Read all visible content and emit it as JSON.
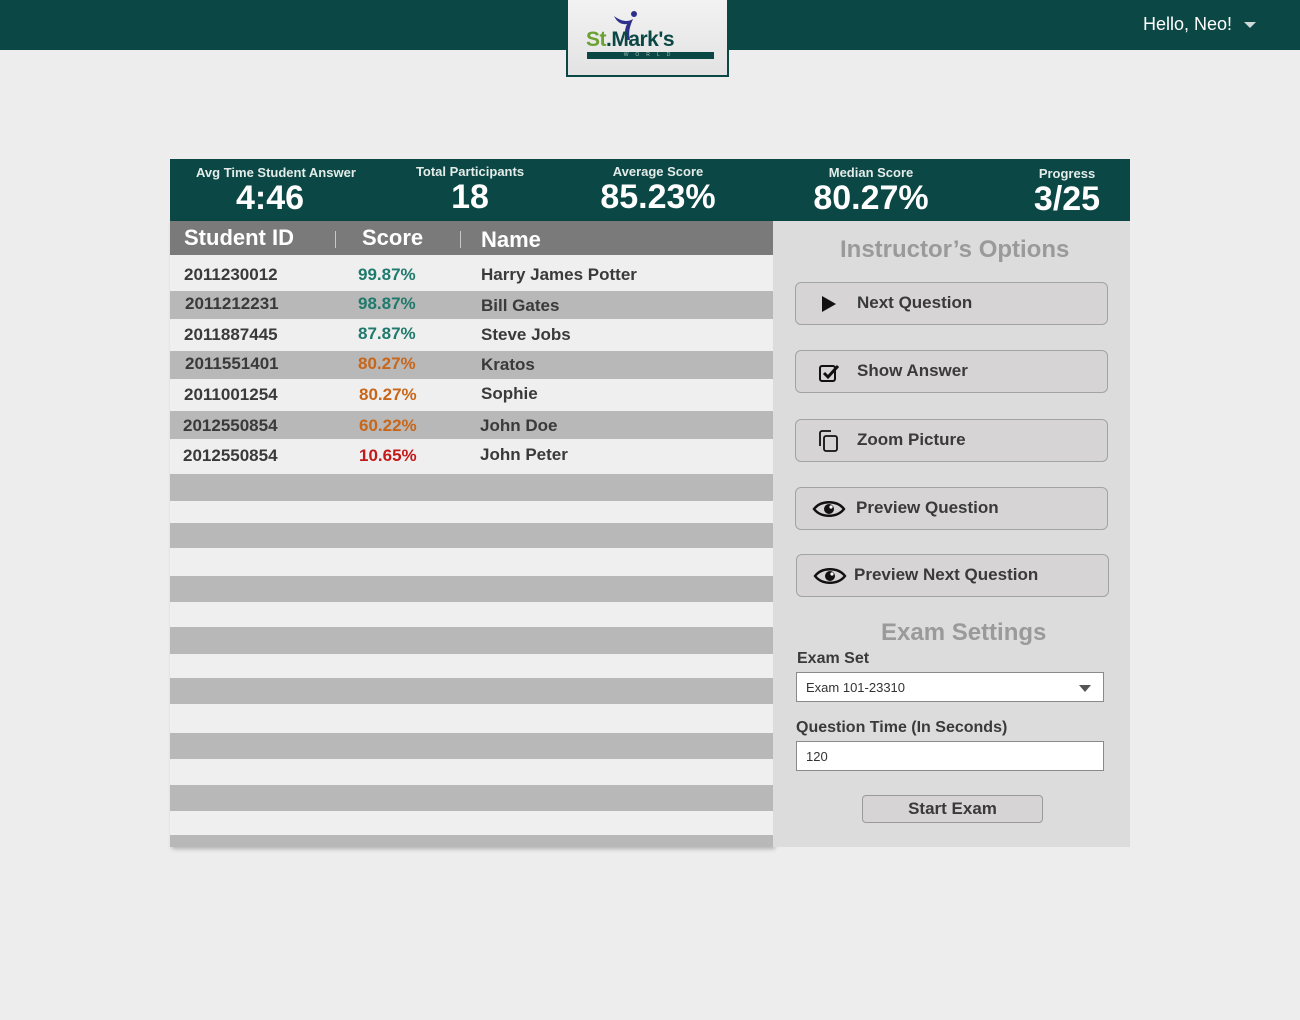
{
  "header": {
    "logo_text_st": "St",
    "logo_text_rest": ".Mark's",
    "logo_sub": "WORLD",
    "greeting": "Hello, Neo!"
  },
  "stats": [
    {
      "label": "Avg Time Student Answer",
      "value": "4:46"
    },
    {
      "label": "Total Participants",
      "value": "18"
    },
    {
      "label": "Average Score",
      "value": "85.23%"
    },
    {
      "label": "Median Score",
      "value": "80.27%"
    },
    {
      "label": "Progress",
      "value": "3/25"
    }
  ],
  "table": {
    "columns": [
      "Student ID",
      "Score",
      "Name"
    ],
    "rows": [
      {
        "id": "2011230012",
        "score": "99.87%",
        "name": "Harry James Potter",
        "color": "#1f7a6c"
      },
      {
        "id": "2011212231",
        "score": "98.87%",
        "name": "Bill Gates",
        "color": "#1f7a6c"
      },
      {
        "id": "2011887445",
        "score": "87.87%",
        "name": "Steve Jobs",
        "color": "#1f7a6c"
      },
      {
        "id": "2011551401",
        "score": "80.27%",
        "name": "Kratos",
        "color": "#c8661a"
      },
      {
        "id": "2011001254",
        "score": "80.27%",
        "name": "Sophie",
        "color": "#c8661a"
      },
      {
        "id": "2012550854",
        "score": "60.22%",
        "name": "John Doe",
        "color": "#c8661a"
      },
      {
        "id": "2012550854",
        "score": "10.65%",
        "name": "John Peter",
        "color": "#c21a1a"
      }
    ]
  },
  "options": {
    "title": "Instructor’s Options",
    "buttons": [
      {
        "label": "Next Question",
        "icon": "play-icon"
      },
      {
        "label": "Show Answer",
        "icon": "checkbox-icon"
      },
      {
        "label": "Zoom Picture",
        "icon": "copy-icon"
      },
      {
        "label": "Preview Question",
        "icon": "eye-icon"
      },
      {
        "label": "Preview Next Question",
        "icon": "eye-icon"
      }
    ]
  },
  "settings": {
    "title": "Exam Settings",
    "exam_set_label": "Exam Set",
    "exam_set_value": "Exam 101-23310",
    "question_time_label": "Question Time (In Seconds)",
    "question_time_value": "120",
    "start_label": "Start Exam"
  }
}
